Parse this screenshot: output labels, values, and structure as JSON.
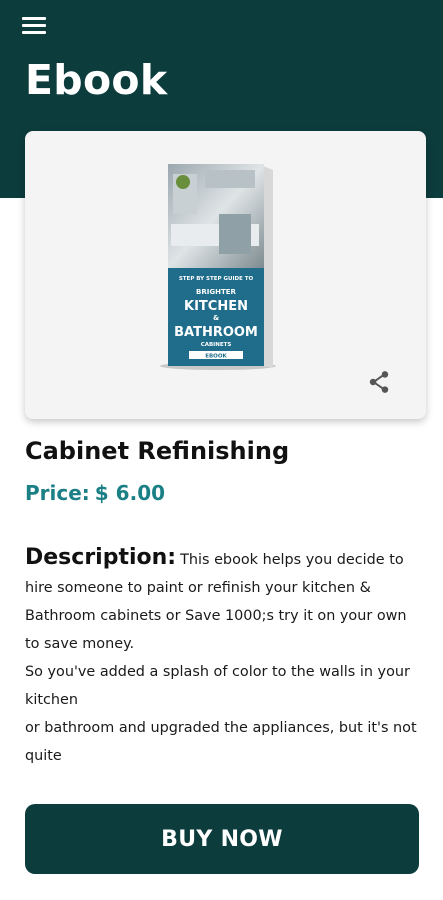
{
  "app_bar": {
    "title": "Ebook",
    "menu_icon": "hamburger-menu-icon"
  },
  "colors": {
    "header": "#0d3c3d",
    "price": "#1b7f86",
    "button": "#0d3c3d"
  },
  "card": {
    "share_icon": "share-icon",
    "book_cover": {
      "line1": "STEP BY STEP GUIDE TO",
      "line2": "BRIGHTER",
      "line3": "KITCHEN",
      "line4": "&",
      "line5": "BATHROOM",
      "line6": "CABINETS",
      "tag": "EBOOK"
    }
  },
  "product": {
    "title": "Cabinet Refinishing",
    "price_label": "Price:",
    "price_value": "$ 6.00"
  },
  "description": {
    "heading": "Description:",
    "line1": "This ebook helps you decide to hire  someone to paint or refinish your kitchen & Bathroom cabinets or Save 1000;s try it on your own to save money.",
    "line2": "So you've added a splash of color to the walls in your kitchen",
    "line3": "or bathroom and upgraded the appliances, but it's not quite"
  },
  "buy_button": {
    "label": "BUY NOW"
  }
}
